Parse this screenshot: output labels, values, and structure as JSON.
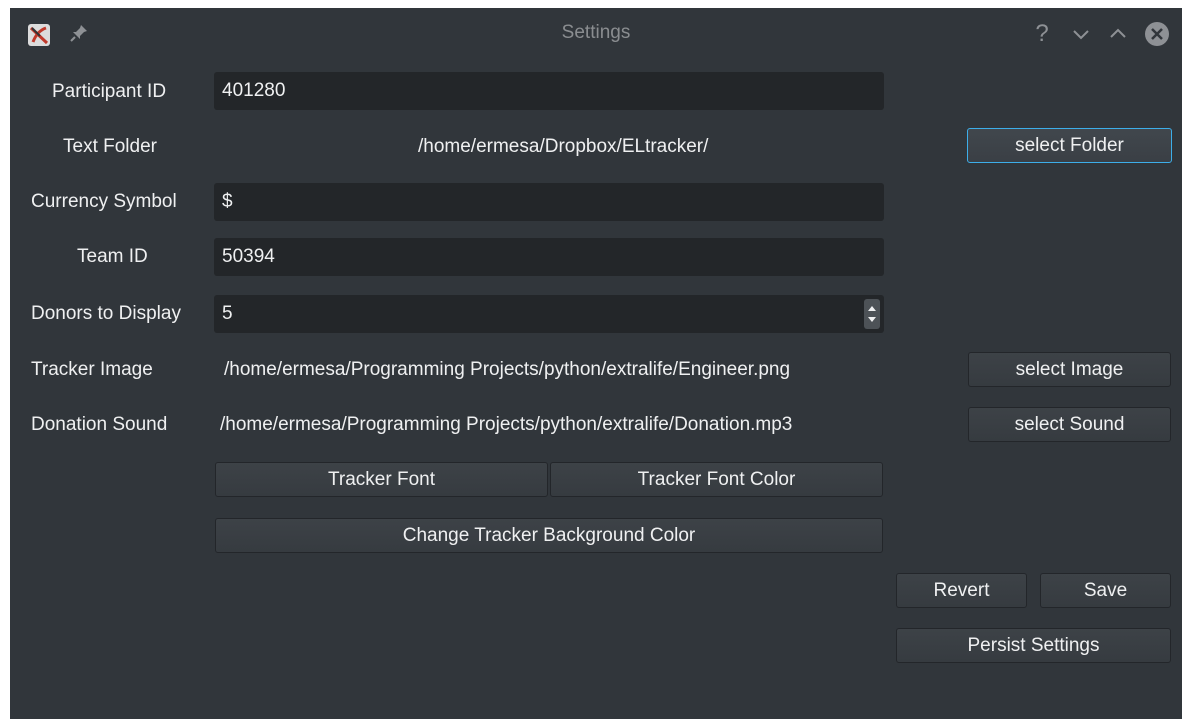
{
  "window": {
    "title": "Settings",
    "help_glyph": "?",
    "minimize_glyph": "⌄",
    "maximize_glyph": "⌃",
    "close_glyph": "✕"
  },
  "form": {
    "participant_id": {
      "label": "Participant ID",
      "value": "401280"
    },
    "text_folder": {
      "label": "Text Folder",
      "value": "/home/ermesa/Dropbox/ELtracker/",
      "button": "select Folder"
    },
    "currency_symbol": {
      "label": "Currency Symbol",
      "value": "$"
    },
    "team_id": {
      "label": "Team ID",
      "value": "50394"
    },
    "donors_to_display": {
      "label": "Donors to Display",
      "value": "5"
    },
    "tracker_image": {
      "label": "Tracker Image",
      "value": "/home/ermesa/Programming Projects/python/extralife/Engineer.png",
      "button": "select Image"
    },
    "donation_sound": {
      "label": "Donation Sound",
      "value": "/home/ermesa/Programming Projects/python/extralife/Donation.mp3",
      "button": "select Sound"
    }
  },
  "buttons": {
    "tracker_font": "Tracker Font",
    "tracker_font_color": "Tracker Font Color",
    "change_bg_color": "Change Tracker Background Color",
    "revert": "Revert",
    "save": "Save",
    "persist": "Persist Settings"
  },
  "icons": {
    "app": "app-logo-icon",
    "pin": "pin-icon"
  },
  "colors": {
    "window_bg": "#31363b",
    "field_bg": "#232629",
    "focus_accent": "#3daee9",
    "text": "#eff0f1"
  }
}
